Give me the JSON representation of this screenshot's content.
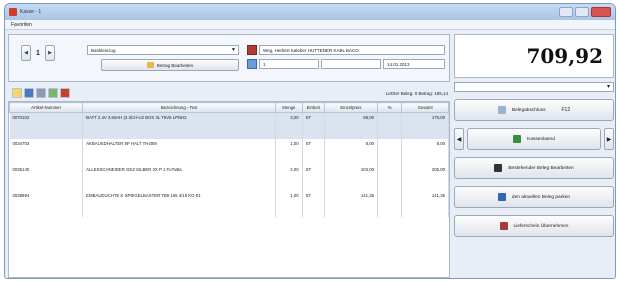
{
  "window": {
    "title": "Kasse - 1"
  },
  "menu": {
    "favorites": "Favoriten"
  },
  "header": {
    "doc_number": "1",
    "doc_type": "Bankleinzug",
    "customer": "Weg, Herbert Kaleber HUTTENER KABL BACO",
    "edit_payment_button": "Betrag Bearbeiten",
    "qty_field": "1",
    "field_blank": "",
    "date": "14.01.2013"
  },
  "toolbar": {
    "last_payment": "Letzter Beleg: 0 Betrag: 185,14"
  },
  "grid": {
    "columns": [
      "Artikel-Nummer",
      "Bezeichnung - Text",
      "Menge",
      "Einheit",
      "Einzelpreis",
      "%",
      "Gesamt"
    ],
    "rows": [
      {
        "nr": "0070102",
        "text": "BATT 2.4V 3.60AH (3.3CH-U2 BOX 3L T6V6 LPNH2",
        "menge": "3,00",
        "einheit": "ST",
        "preis": "59,00",
        "rabatt": "",
        "gesamt": "175,00"
      },
      {
        "nr": "0034703",
        "text": "AKBAUSDHALTER 8P HALT TH40M",
        "menge": "1,00",
        "einheit": "ST",
        "preis": "8,00",
        "rabatt": "",
        "gesamt": "8,00"
      },
      {
        "nr": "0035140",
        "text": "ALLESSCHNEIDER GEZ SILBER 3X P 1 FuTuBa",
        "menge": "2,00",
        "einheit": "ST",
        "preis": "103,00",
        "rabatt": "",
        "gesamt": "206,00"
      },
      {
        "nr": "0038894",
        "text": "EMBAUDUCHTE K SPIEGELBASTER TB9 165 4/15 KG-01",
        "menge": "1,00",
        "einheit": "ST",
        "preis": "141,35",
        "rabatt": "",
        "gesamt": "141,35"
      }
    ]
  },
  "sidebar": {
    "total": "709,92",
    "select_value": "",
    "close_receipt": {
      "label": "Belegabschluss",
      "key": "F12"
    },
    "cash_drawer": {
      "label": "Kassenlaend"
    },
    "edit_existing": {
      "label": "Bestehender Beleg Bearbeiten"
    },
    "park_receipt": {
      "label": "den aktuellen Beleg parken"
    },
    "take_over": {
      "label": "Lieferschein Übernehmen"
    }
  },
  "colors": {
    "accent": "#2f5fa8",
    "titlebar": "#b7cdea",
    "close": "#d9534f"
  }
}
